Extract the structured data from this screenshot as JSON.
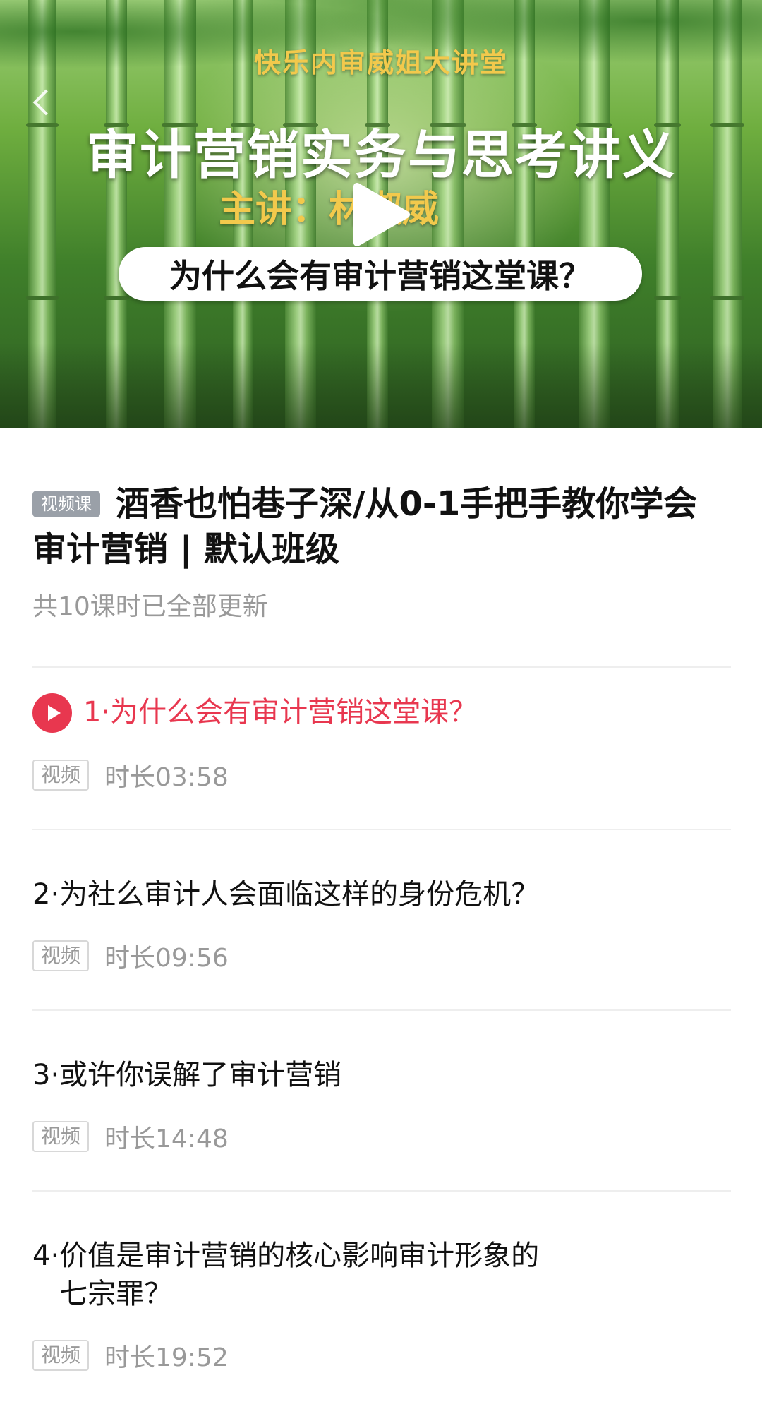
{
  "banner": {
    "series_title": "快乐内审威姐大讲堂",
    "course_title": "审计营销实务与思考讲义",
    "speaker": "主讲：林淑威",
    "episode_title": "为什么会有审计营销这堂课？"
  },
  "course": {
    "tag": "视频课",
    "title": "酒香也怕巷子深/从0-1手把手教你学会审计营销 | 默认班级",
    "meta": "共10课时已全部更新"
  },
  "lessons": [
    {
      "number": "1·",
      "title": "为什么会有审计营销这堂课？",
      "type": "视频",
      "duration": "时长03:58",
      "active": true
    },
    {
      "number": "2·",
      "title": "为社么审计人会面临这样的身份危机？",
      "type": "视频",
      "duration": "时长09:56",
      "active": false
    },
    {
      "number": "3·",
      "title": "或许你误解了审计营销",
      "type": "视频",
      "duration": "时长14:48",
      "active": false
    },
    {
      "number": "4·",
      "title": "价值是审计营销的核心影响审计形象的七宗罪？",
      "type": "视频",
      "duration": "时长19:52",
      "active": false
    }
  ],
  "colors": {
    "accent": "#e8374f",
    "muted_text": "#999999",
    "divider": "#eeeeee"
  },
  "icons": {
    "back": "chevron-left-icon",
    "play": "play-icon"
  }
}
